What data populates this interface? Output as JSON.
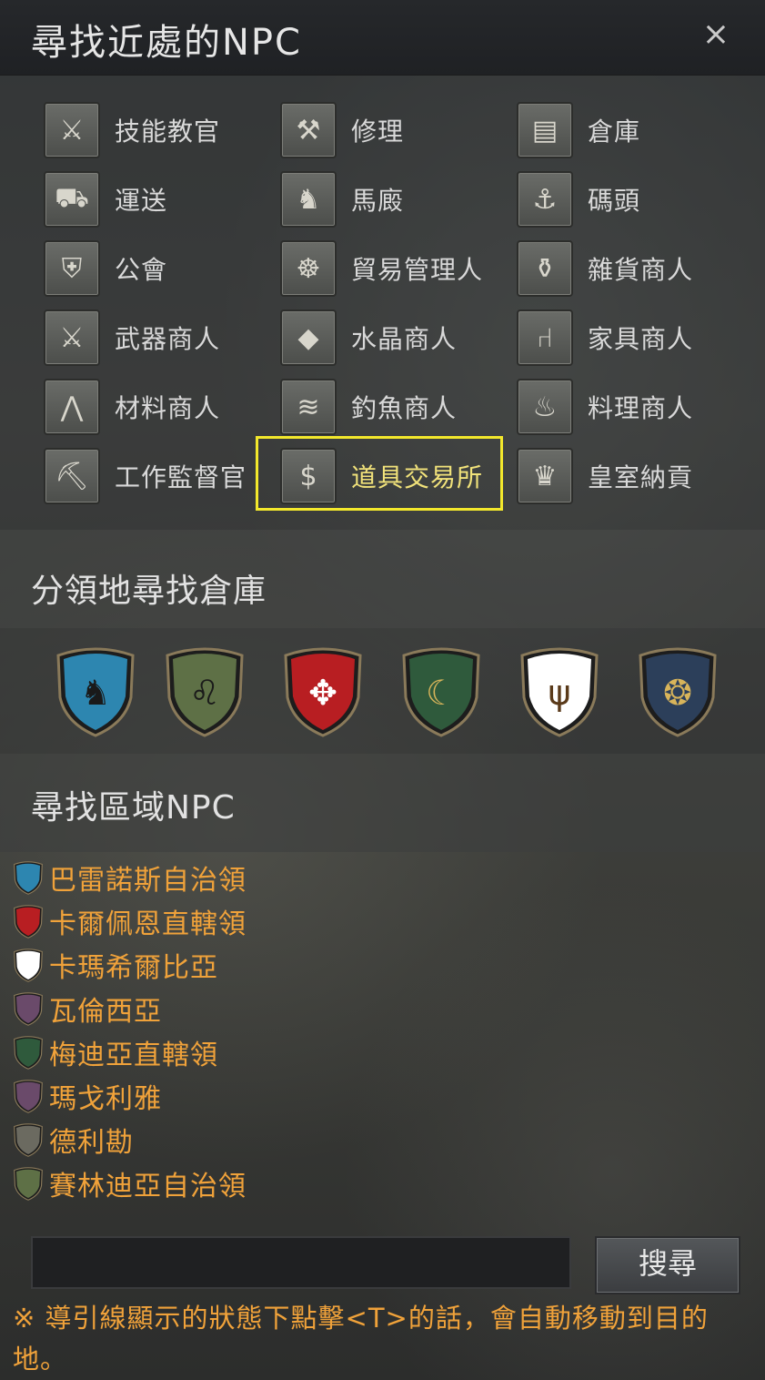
{
  "window": {
    "title": "尋找近處的NPC",
    "close_glyph": "×"
  },
  "npc_types": [
    {
      "label": "技能教官",
      "icon": "crossed-axes-icon",
      "glyph": "⚔",
      "selected": false
    },
    {
      "label": "修理",
      "icon": "anvil-icon",
      "glyph": "⚒",
      "selected": false
    },
    {
      "label": "倉庫",
      "icon": "chest-icon",
      "glyph": "▤",
      "selected": false
    },
    {
      "label": "運送",
      "icon": "wagon-icon",
      "glyph": "⛟",
      "selected": false
    },
    {
      "label": "馬廄",
      "icon": "horse-icon",
      "glyph": "♞",
      "selected": false
    },
    {
      "label": "碼頭",
      "icon": "anchor-icon",
      "glyph": "⚓",
      "selected": false
    },
    {
      "label": "公會",
      "icon": "guild-crest-icon",
      "glyph": "⛨",
      "selected": false
    },
    {
      "label": "貿易管理人",
      "icon": "wheel-icon",
      "glyph": "☸",
      "selected": false
    },
    {
      "label": "雜貨商人",
      "icon": "potion-icon",
      "glyph": "⚱",
      "selected": false
    },
    {
      "label": "武器商人",
      "icon": "weapon-shield-icon",
      "glyph": "⚔",
      "selected": false
    },
    {
      "label": "水晶商人",
      "icon": "diamond-icon",
      "glyph": "◆",
      "selected": false
    },
    {
      "label": "家具商人",
      "icon": "armchair-icon",
      "glyph": "⑁",
      "selected": false
    },
    {
      "label": "材料商人",
      "icon": "pick-tool-icon",
      "glyph": "⋀",
      "selected": false
    },
    {
      "label": "釣魚商人",
      "icon": "fish-icon",
      "glyph": "≋",
      "selected": false
    },
    {
      "label": "料理商人",
      "icon": "roast-chicken-icon",
      "glyph": "♨",
      "selected": false
    },
    {
      "label": "工作監督官",
      "icon": "pickaxe-icon",
      "glyph": "⛏",
      "selected": false
    },
    {
      "label": "道具交易所",
      "icon": "money-bag-icon",
      "glyph": "$",
      "selected": true
    },
    {
      "label": "皇室納貢",
      "icon": "royal-cart-icon",
      "glyph": "♛",
      "selected": false
    }
  ],
  "territory": {
    "title": "分領地尋找倉庫",
    "shields": [
      {
        "name": "balenos-shield-icon",
        "color": "#2d86b0",
        "emblem": "horse"
      },
      {
        "name": "serendia-shield-icon",
        "color": "#5e7046",
        "emblem": "lion"
      },
      {
        "name": "calpheon-shield-icon",
        "color": "#b81e22",
        "emblem": "eagle"
      },
      {
        "name": "mediah-shield-icon",
        "color": "#2f5a3c",
        "emblem": "moons"
      },
      {
        "name": "kamasylvia-shield-icon",
        "color": "#ffffff",
        "emblem": "antlers"
      },
      {
        "name": "valencia-shield-icon",
        "color": "#2c3f5a",
        "emblem": "knot"
      }
    ]
  },
  "region_search": {
    "title": "尋找區域NPC",
    "regions": [
      {
        "label": "巴雷諾斯自治領",
        "color": "#2d86b0"
      },
      {
        "label": "卡爾佩恩直轄領",
        "color": "#b81e22"
      },
      {
        "label": "卡瑪希爾比亞",
        "color": "#ffffff"
      },
      {
        "label": "瓦倫西亞",
        "color": "#6a4a6a"
      },
      {
        "label": "梅迪亞直轄領",
        "color": "#2f5a3c"
      },
      {
        "label": "瑪戈利雅",
        "color": "#6a4a6a"
      },
      {
        "label": "德利勘",
        "color": "#6b6a60"
      },
      {
        "label": "賽林迪亞自治領",
        "color": "#5e7046"
      }
    ]
  },
  "search": {
    "value": "",
    "button_label": "搜尋"
  },
  "hint": "※ 導引線顯示的狀態下點擊<T>的話，會自動移動到目的地。"
}
